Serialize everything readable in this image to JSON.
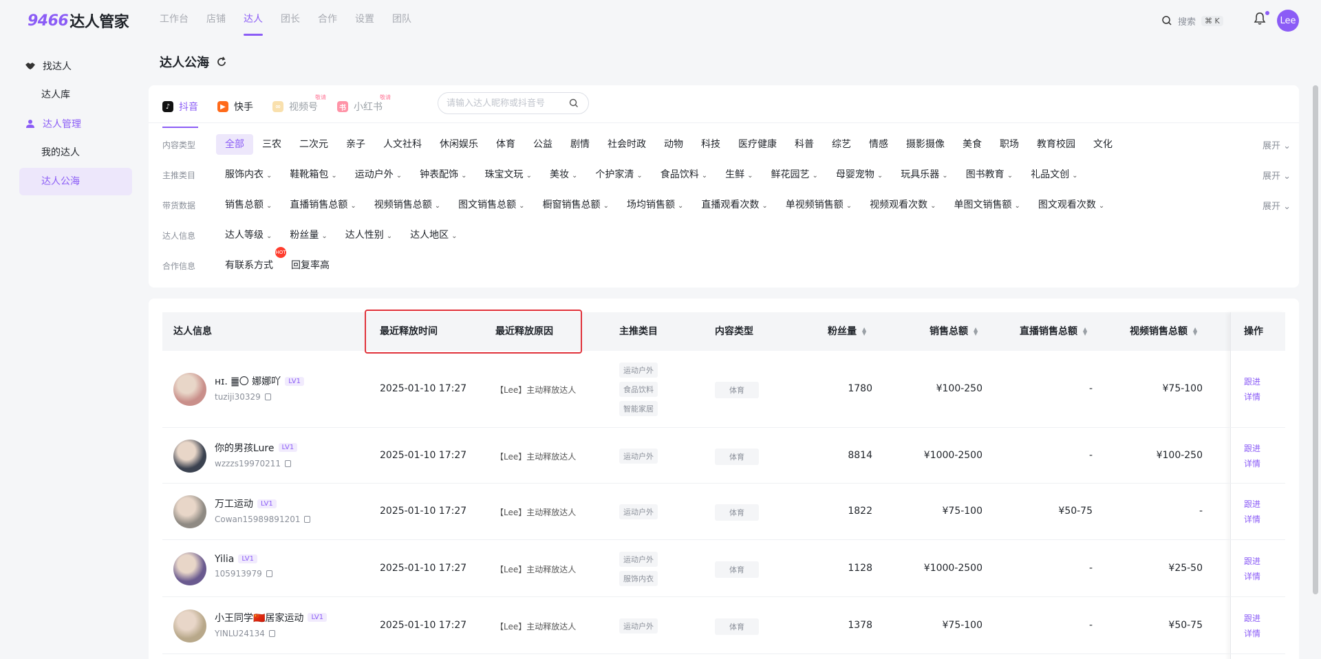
{
  "brand": {
    "logo_num": "9466",
    "logo_text": "达人管家"
  },
  "nav": {
    "items": [
      "工作台",
      "店铺",
      "达人",
      "团长",
      "合作",
      "设置",
      "团队"
    ],
    "active": 2
  },
  "header": {
    "search_label": "搜索",
    "search_kbd": "⌘ K",
    "user_initials": "Lee"
  },
  "sidebar": {
    "groups": [
      {
        "label": "找达人",
        "items": [
          "达人库"
        ]
      },
      {
        "label": "达人管理",
        "items": [
          "我的达人",
          "达人公海"
        ]
      }
    ]
  },
  "page": {
    "title": "达人公海"
  },
  "platforms": [
    {
      "label": "抖音",
      "badge": ""
    },
    {
      "label": "快手",
      "badge": ""
    },
    {
      "label": "视频号",
      "badge": "敬请"
    },
    {
      "label": "小红书",
      "badge": "敬请"
    }
  ],
  "search": {
    "placeholder": "请输入达人昵称或抖音号"
  },
  "filters": {
    "expand_label": "展开",
    "content_type": {
      "label": "内容类型",
      "options": [
        "全部",
        "三农",
        "二次元",
        "亲子",
        "人文社科",
        "休闲娱乐",
        "体育",
        "公益",
        "剧情",
        "社会时政",
        "动物",
        "科技",
        "医疗健康",
        "科普",
        "综艺",
        "情感",
        "摄影摄像",
        "美食",
        "职场",
        "教育校园",
        "文化"
      ]
    },
    "main_category": {
      "label": "主推类目",
      "options": [
        "服饰内衣",
        "鞋靴箱包",
        "运动户外",
        "钟表配饰",
        "珠宝文玩",
        "美妆",
        "个护家清",
        "食品饮料",
        "生鲜",
        "鲜花园艺",
        "母婴宠物",
        "玩具乐器",
        "图书教育",
        "礼品文创"
      ]
    },
    "sales_data": {
      "label": "带货数据",
      "options": [
        "销售总额",
        "直播销售总额",
        "视频销售总额",
        "图文销售总额",
        "橱窗销售总额",
        "场均销售额",
        "直播观看次数",
        "单视频销售额",
        "视频观看次数",
        "单图文销售额",
        "图文观看次数"
      ]
    },
    "kol_info": {
      "label": "达人信息",
      "options": [
        "达人等级",
        "粉丝量",
        "达人性别",
        "达人地区"
      ]
    },
    "coop_info": {
      "label": "合作信息",
      "options": [
        "有联系方式",
        "回复率高"
      ],
      "hot_badge": "HOT"
    }
  },
  "table": {
    "headers": {
      "kol": "达人信息",
      "release_time": "最近释放时间",
      "release_reason": "最近释放原因",
      "main_cat": "主推类目",
      "content_type": "内容类型",
      "fans": "粉丝量",
      "sales": "销售总额",
      "live_sales": "直播销售总额",
      "video_sales": "视频销售总额",
      "ops": "操作"
    },
    "rows": [
      {
        "name": "ʜɪ. ䷀〇 娜娜吖",
        "level": "LV1",
        "account": "tuziji30329",
        "time": "2025-01-10 17:27",
        "reason": "【Lee】主动释放达人",
        "cats": [
          "运动户外",
          "食品饮料",
          "智能家居"
        ],
        "type": "体育",
        "fans": "1780",
        "sales": "¥100-250",
        "live": "-",
        "video": "¥75-100",
        "op1": "跟进",
        "op2": "详情"
      },
      {
        "name": "你的男孩Lure",
        "level": "LV1",
        "account": "wzzzs19970211",
        "time": "2025-01-10 17:27",
        "reason": "【Lee】主动释放达人",
        "cats": [
          "运动户外"
        ],
        "type": "体育",
        "fans": "8814",
        "sales": "¥1000-2500",
        "live": "-",
        "video": "¥100-250",
        "op1": "跟进",
        "op2": "详情"
      },
      {
        "name": "万工运动",
        "level": "LV1",
        "account": "Cowan15989891201",
        "time": "2025-01-10 17:27",
        "reason": "【Lee】主动释放达人",
        "cats": [
          "运动户外"
        ],
        "type": "体育",
        "fans": "1822",
        "sales": "¥75-100",
        "live": "¥50-75",
        "video": "-",
        "op1": "跟进",
        "op2": "详情"
      },
      {
        "name": "Yilia",
        "level": "LV1",
        "account": "105913979",
        "time": "2025-01-10 17:27",
        "reason": "【Lee】主动释放达人",
        "cats": [
          "运动户外",
          "服饰内衣"
        ],
        "type": "体育",
        "fans": "1128",
        "sales": "¥1000-2500",
        "live": "-",
        "video": "¥25-50",
        "op1": "跟进",
        "op2": "详情"
      },
      {
        "name": "小王同学🇨🇳居家运动",
        "level": "LV1",
        "account": "YINLU24134",
        "time": "2025-01-10 17:27",
        "reason": "【Lee】主动释放达人",
        "cats": [
          "运动户外"
        ],
        "type": "体育",
        "fans": "1378",
        "sales": "¥75-100",
        "live": "-",
        "video": "¥50-75",
        "op1": "跟进",
        "op2": "详情"
      }
    ]
  },
  "colors": {
    "accent": "#8b5cf6",
    "highlight_border": "#e0313a"
  }
}
